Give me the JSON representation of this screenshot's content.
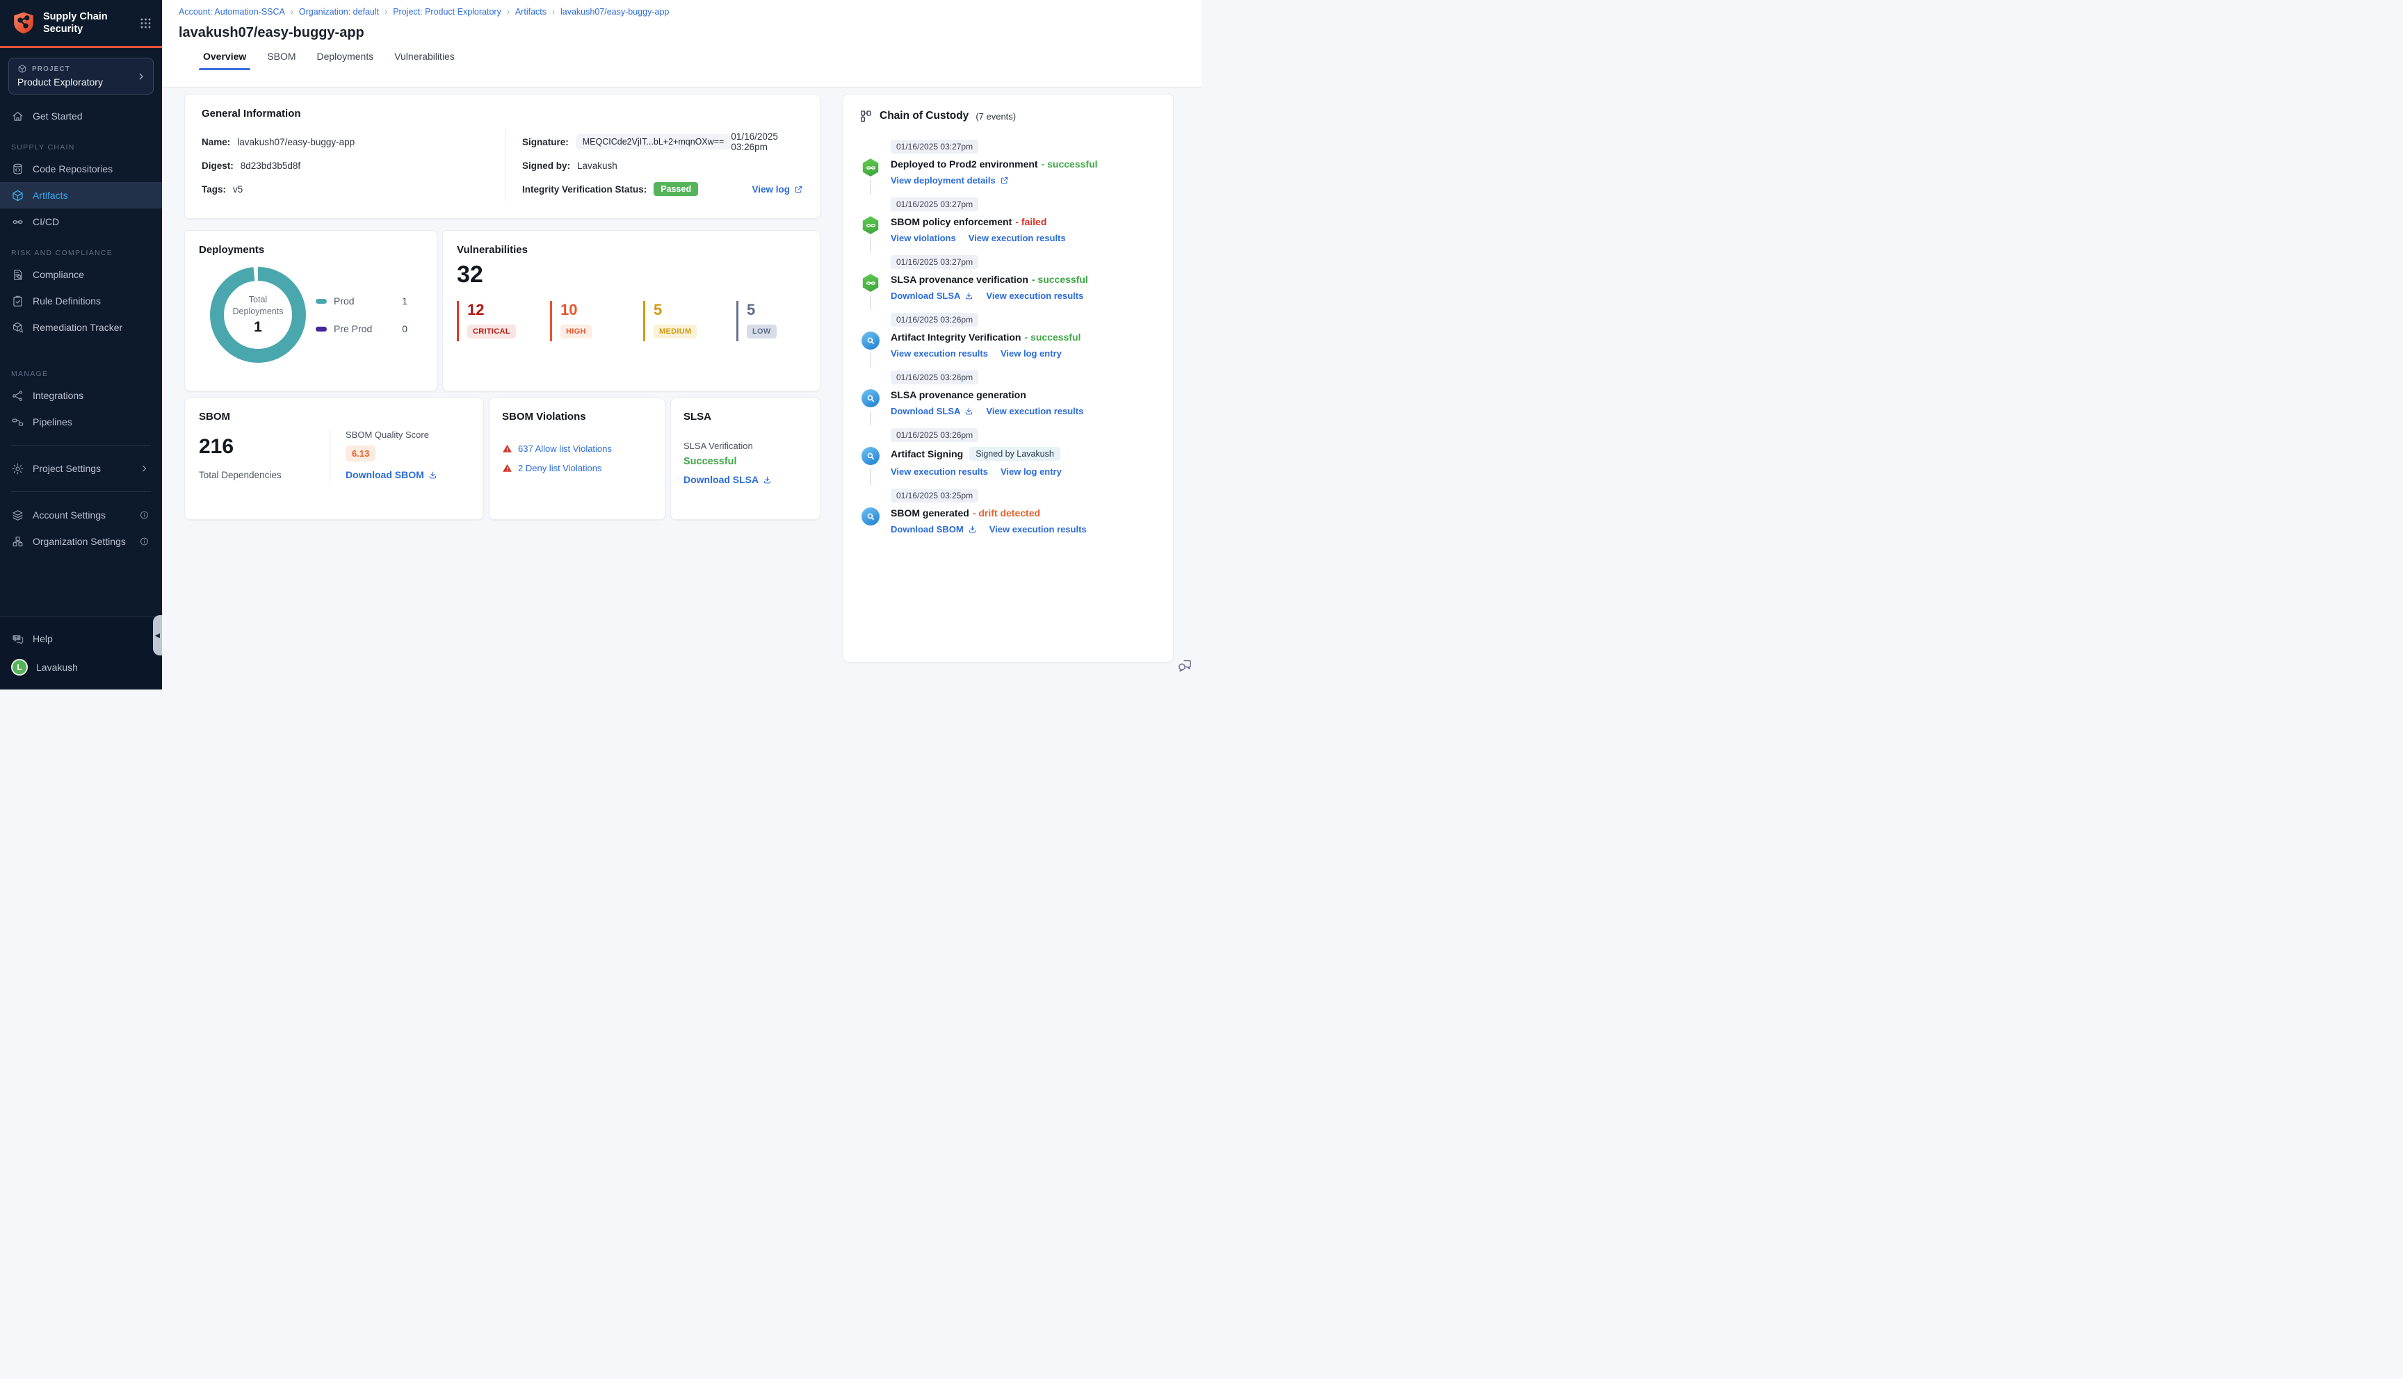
{
  "brand": {
    "app_title": "Supply Chain Security",
    "accent_color": "#e8503a"
  },
  "colors": {
    "link": "#2b6bd9",
    "success": "#3fa746",
    "error": "#da3023",
    "warning": "#e8612c",
    "passed_badge": "#55b35a",
    "donut": "#4ba7ae",
    "preprod": "#45249c",
    "sidebar_bg": "#0d1a2c"
  },
  "sidebar": {
    "project_label": "PROJECT",
    "project_name": "Product Exploratory",
    "nav": [
      {
        "type": "item",
        "icon": "home",
        "label": "Get Started"
      },
      {
        "type": "section",
        "label": "SUPPLY CHAIN"
      },
      {
        "type": "item",
        "icon": "repo",
        "label": "Code Repositories"
      },
      {
        "type": "item",
        "icon": "cube",
        "label": "Artifacts",
        "active": true
      },
      {
        "type": "item",
        "icon": "infinity",
        "label": "CI/CD"
      },
      {
        "type": "section",
        "label": "RISK AND COMPLIANCE"
      },
      {
        "type": "item",
        "icon": "docsearch",
        "label": "Compliance"
      },
      {
        "type": "item",
        "icon": "clipboard",
        "label": "Rule Definitions"
      },
      {
        "type": "item",
        "icon": "boxwrench",
        "label": "Remediation Tracker"
      },
      {
        "type": "section",
        "label": "MANAGE",
        "gap": "lg"
      },
      {
        "type": "item",
        "icon": "share",
        "label": "Integrations"
      },
      {
        "type": "item",
        "icon": "pipeline",
        "label": "Pipelines"
      },
      {
        "type": "divider"
      },
      {
        "type": "item",
        "icon": "gear",
        "label": "Project Settings",
        "chevron": true
      },
      {
        "type": "divider"
      },
      {
        "type": "item",
        "icon": "layers",
        "label": "Account Settings",
        "info": true
      },
      {
        "type": "item",
        "icon": "org",
        "label": "Organization Settings",
        "info": true
      }
    ],
    "help_label": "Help",
    "user_name": "Lavakush",
    "user_initial": "L"
  },
  "breadcrumb": {
    "separator": "›",
    "items": [
      "Account: Automation-SSCA",
      "Organization: default",
      "Project: Product Exploratory",
      "Artifacts",
      "lavakush07/easy-buggy-app"
    ]
  },
  "page": {
    "title": "lavakush07/easy-buggy-app",
    "tabs": [
      {
        "label": "Overview",
        "active": true
      },
      {
        "label": "SBOM"
      },
      {
        "label": "Deployments"
      },
      {
        "label": "Vulnerabilities"
      }
    ]
  },
  "general_info": {
    "title": "General Information",
    "name_label": "Name:",
    "name_value": "lavakush07/easy-buggy-app",
    "digest_label": "Digest:",
    "digest_value": "8d23bd3b5d8f",
    "tags_label": "Tags:",
    "tags_value": "v5",
    "signature_label": "Signature:",
    "signature_value": "MEQCICde2VjIT...bL+2+mqnOXw==",
    "signature_date": "01/16/2025 03:26pm",
    "signed_by_label": "Signed by:",
    "signed_by_value": "Lavakush",
    "integrity_label": "Integrity Verification Status:",
    "integrity_status": "Passed",
    "view_log_label": "View log"
  },
  "deployments": {
    "title": "Deployments",
    "center_label": "Total Deployments",
    "center_value": "1",
    "legend": [
      {
        "label": "Prod",
        "value": "1",
        "color": "#4ba7ae"
      },
      {
        "label": "Pre Prod",
        "value": "0",
        "color": "#45249c"
      }
    ]
  },
  "vulnerabilities": {
    "title": "Vulnerabilities",
    "total": "32",
    "severities": [
      {
        "count": "12",
        "label": "CRITICAL",
        "num": "#b0170f",
        "bar": "#e23b2a",
        "bg": "#f9e6e4"
      },
      {
        "count": "10",
        "label": "HIGH",
        "num": "#e8562e",
        "bar": "#e8562e",
        "bg": "#fdeee5"
      },
      {
        "count": "5",
        "label": "MEDIUM",
        "num": "#d19a12",
        "bar": "#d19a12",
        "bg": "#faf2d7"
      },
      {
        "count": "5",
        "label": "LOW",
        "num": "#5d6d8a",
        "bar": "#64748f",
        "bg": "#d8dce6"
      }
    ]
  },
  "sbom": {
    "title": "SBOM",
    "total": "216",
    "total_label": "Total Dependencies",
    "quality_label": "SBOM Quality Score",
    "quality_score": "6.13",
    "download_label": "Download SBOM"
  },
  "sbom_violations": {
    "title": "SBOM Violations",
    "items": [
      "637 Allow list Violations",
      "2 Deny list Violations"
    ]
  },
  "slsa": {
    "title": "SLSA",
    "verification_label": "SLSA Verification",
    "status": "Successful",
    "download_label": "Download SLSA"
  },
  "custody": {
    "title": "Chain of Custody",
    "count": "(7 events)",
    "events": [
      {
        "time": "01/16/2025 03:27pm",
        "icon": "pipeline",
        "title": "Deployed to Prod2 environment",
        "status": "successful",
        "tone": "green",
        "links": [
          {
            "text": "View deployment details",
            "icon": "external"
          }
        ]
      },
      {
        "time": "01/16/2025 03:27pm",
        "icon": "pipeline",
        "title": "SBOM policy enforcement",
        "status": "failed",
        "tone": "red",
        "links": [
          {
            "text": "View violations"
          },
          {
            "text": "View execution results"
          }
        ]
      },
      {
        "time": "01/16/2025 03:27pm",
        "icon": "pipeline",
        "title": "SLSA provenance verification",
        "status": "successful",
        "tone": "green",
        "links": [
          {
            "text": "Download SLSA",
            "icon": "download"
          },
          {
            "text": "View execution results"
          }
        ]
      },
      {
        "time": "01/16/2025 03:26pm",
        "icon": "scan",
        "title": "Artifact Integrity Verification",
        "status": "successful",
        "tone": "green",
        "links": [
          {
            "text": "View execution results"
          },
          {
            "text": "View log entry"
          }
        ]
      },
      {
        "time": "01/16/2025 03:26pm",
        "icon": "scan",
        "title": "SLSA provenance generation",
        "links": [
          {
            "text": "Download SLSA",
            "icon": "download"
          },
          {
            "text": "View execution results"
          }
        ]
      },
      {
        "time": "01/16/2025 03:26pm",
        "icon": "scan",
        "title": "Artifact Signing",
        "badge": "Signed by Lavakush",
        "links": [
          {
            "text": "View execution results"
          },
          {
            "text": "View log entry"
          }
        ]
      },
      {
        "time": "01/16/2025 03:25pm",
        "icon": "scan",
        "title": "SBOM generated",
        "status": "drift detected",
        "tone": "orange",
        "links": [
          {
            "text": "Download SBOM",
            "icon": "download"
          },
          {
            "text": "View execution results"
          }
        ]
      }
    ]
  },
  "chart_data": [
    {
      "type": "pie",
      "title": "Deployments",
      "labels": [
        "Prod",
        "Pre Prod"
      ],
      "values": [
        1,
        0
      ],
      "colors": [
        "#4ba7ae",
        "#45249c"
      ],
      "center_label": "Total Deployments",
      "center_value": 1,
      "legend_position": "right"
    },
    {
      "type": "bar",
      "title": "Vulnerabilities",
      "categories": [
        "CRITICAL",
        "HIGH",
        "MEDIUM",
        "LOW"
      ],
      "values": [
        12,
        10,
        5,
        5
      ],
      "total": 32,
      "colors": [
        "#b0170f",
        "#e8562e",
        "#d19a12",
        "#64748f"
      ]
    }
  ]
}
